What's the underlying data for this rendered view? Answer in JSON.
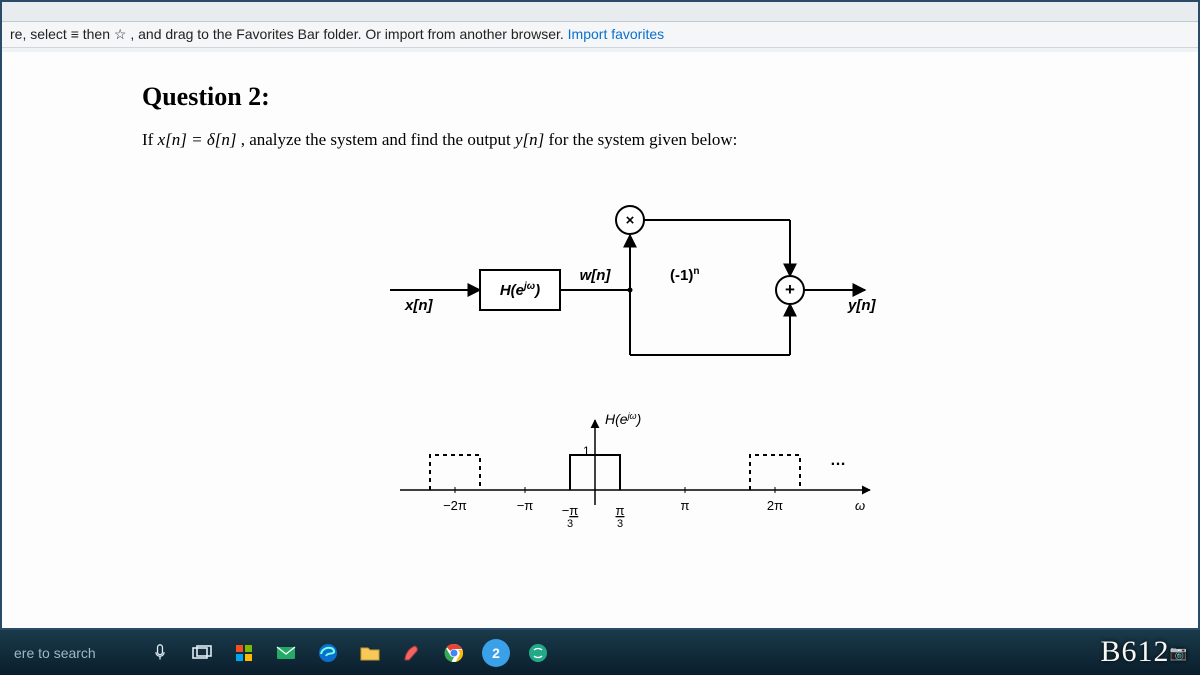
{
  "favbar": {
    "prefix": "re, select ≡ then ",
    "star": "☆",
    "middle": ", and drag to the Favorites Bar folder. Or import from another browser. ",
    "import_link": "Import favorites"
  },
  "question": {
    "title": "Question 2:",
    "prompt_a": "If ",
    "prompt_b": "x[n] = δ[n]",
    "prompt_c": ", analyze the system and find the output ",
    "prompt_d": "y[n]",
    "prompt_e": " for the system given below:"
  },
  "diagram": {
    "xlabel": "x[n]",
    "Hbox": "H(e^{jω})",
    "wlabel": "w[n]",
    "neg1": "(-1)^n",
    "mult": "×",
    "plus": "+",
    "ylabel": "y[n]"
  },
  "plot": {
    "ylabel_top": "H(e^{jω})",
    "one": "1",
    "ticks": {
      "m2pi": "−2π",
      "mpi": "−π",
      "mpi3": "−π/3",
      "pi3": "π/3",
      "pi": "π",
      "p2pi": "2π",
      "omega": "ω",
      "dots": "…"
    }
  },
  "taskbar": {
    "search_placeholder": "ere to search",
    "badge_num": "2"
  },
  "watermark": {
    "text": "B612",
    "sub": "📷"
  }
}
